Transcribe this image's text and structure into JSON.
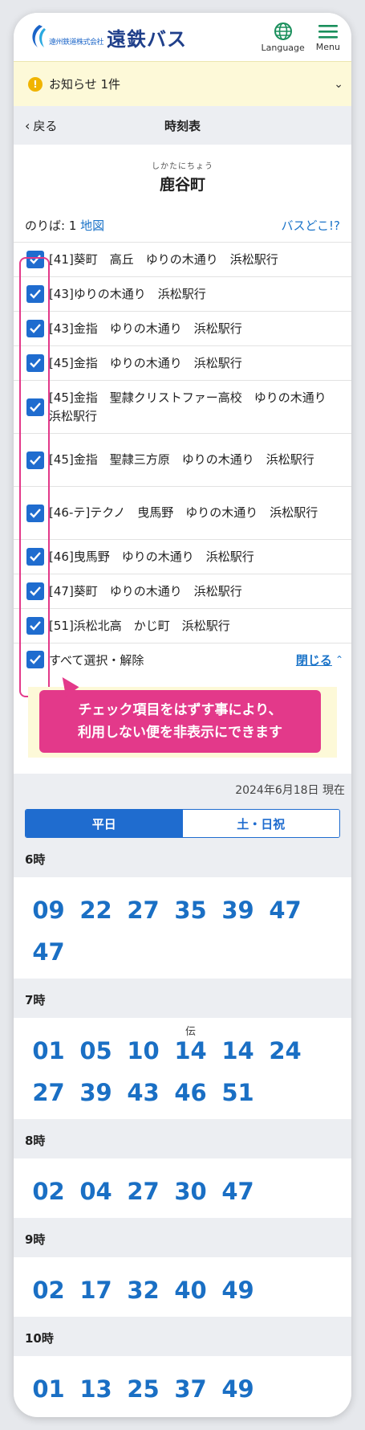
{
  "header": {
    "logo_small": "遠州鉄道株式会社",
    "logo_big": "遠鉄バス",
    "language_label": "Language",
    "menu_label": "Menu"
  },
  "notice": {
    "label": "お知らせ 1件",
    "badge": "!"
  },
  "subnav": {
    "back_label": "戻る",
    "title": "時刻表"
  },
  "stop": {
    "kana": "しかたにちょう",
    "name": "鹿谷町"
  },
  "info": {
    "platform_label": "のりば: 1",
    "map_link": "地図",
    "bus_where": "バスどこ!?"
  },
  "routes": [
    {
      "label": "[41]葵町　高丘　ゆりの木通り　浜松駅行",
      "checked": true
    },
    {
      "label": "[43]ゆりの木通り　浜松駅行",
      "checked": true
    },
    {
      "label": "[43]金指　ゆりの木通り　浜松駅行",
      "checked": true
    },
    {
      "label": "[45]金指　ゆりの木通り　浜松駅行",
      "checked": true
    },
    {
      "label": "[45]金指　聖隷クリストファー高校　ゆりの木通り　浜松駅行",
      "checked": true
    },
    {
      "label": "[45]金指　聖隷三方原　ゆりの木通り　浜松駅行",
      "checked": true
    },
    {
      "label": "[46-テ]テクノ　曳馬野　ゆりの木通り　浜松駅行",
      "checked": true
    },
    {
      "label": "[46]曳馬野　ゆりの木通り　浜松駅行",
      "checked": true
    },
    {
      "label": "[47]葵町　ゆりの木通り　浜松駅行",
      "checked": true
    },
    {
      "label": "[51]浜松北高　かじ町　浜松駅行",
      "checked": true
    }
  ],
  "select_all": {
    "label": "すべて選択・解除",
    "close_label": "閉じる"
  },
  "tip": {
    "line1": "チェック項目をはずす事により、",
    "line2": "利用しない便を非表示にできます"
  },
  "timetable": {
    "as_of": "2024年6月18日 現在",
    "tabs": [
      {
        "label": "平日",
        "active": true
      },
      {
        "label": "土・日祝",
        "active": false
      }
    ],
    "hours": [
      {
        "label": "6時",
        "minutes": [
          {
            "m": "09"
          },
          {
            "m": "22"
          },
          {
            "m": "27"
          },
          {
            "m": "35"
          },
          {
            "m": "39"
          },
          {
            "m": "47"
          },
          {
            "m": "47"
          }
        ]
      },
      {
        "label": "7時",
        "minutes": [
          {
            "m": "01"
          },
          {
            "m": "05"
          },
          {
            "m": "10"
          },
          {
            "m": "14",
            "note": "伝"
          },
          {
            "m": "14"
          },
          {
            "m": "24"
          },
          {
            "m": "27"
          },
          {
            "m": "39"
          },
          {
            "m": "43"
          },
          {
            "m": "46"
          },
          {
            "m": "51"
          }
        ]
      },
      {
        "label": "8時",
        "minutes": [
          {
            "m": "02"
          },
          {
            "m": "04"
          },
          {
            "m": "27"
          },
          {
            "m": "30"
          },
          {
            "m": "47"
          }
        ]
      },
      {
        "label": "9時",
        "minutes": [
          {
            "m": "02"
          },
          {
            "m": "17"
          },
          {
            "m": "32"
          },
          {
            "m": "40"
          },
          {
            "m": "49"
          }
        ]
      },
      {
        "label": "10時",
        "minutes": [
          {
            "m": "01"
          },
          {
            "m": "13"
          },
          {
            "m": "25"
          },
          {
            "m": "37"
          },
          {
            "m": "49"
          }
        ]
      }
    ]
  },
  "colors": {
    "accent": "#1f6ccf",
    "highlight": "#e3398a",
    "notice_bg": "#fdf9d8"
  }
}
